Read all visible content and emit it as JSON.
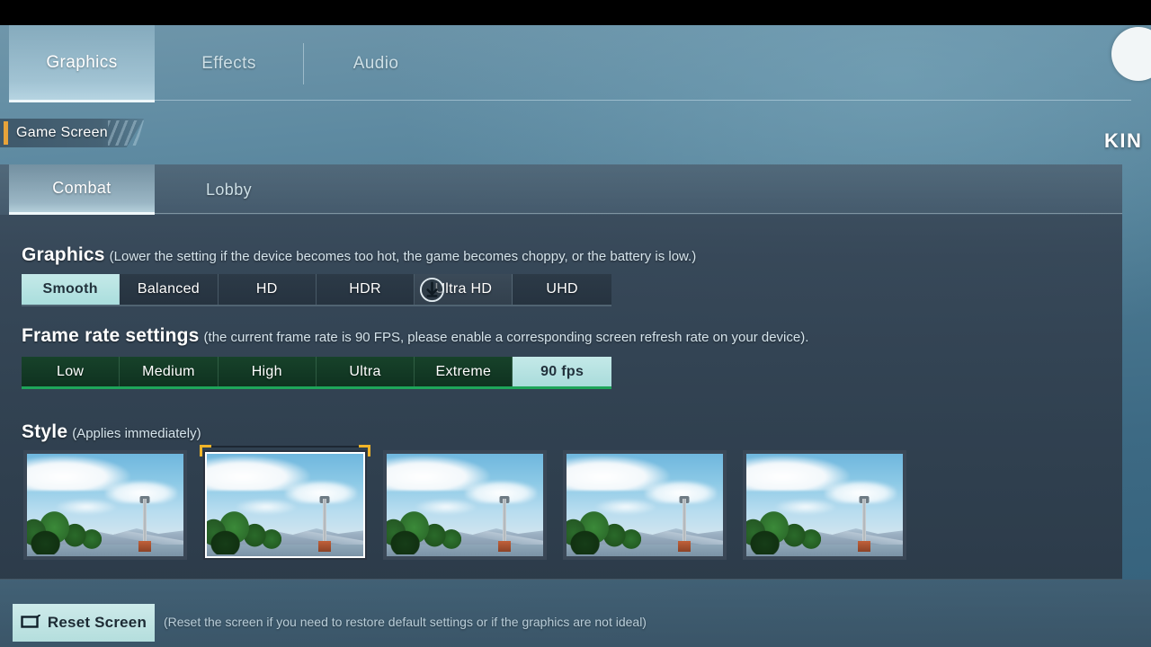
{
  "top_tabs": [
    {
      "label": "Graphics",
      "active": true
    },
    {
      "label": "Effects",
      "active": false
    },
    {
      "label": "Audio",
      "active": false
    }
  ],
  "breadcrumb": {
    "label": "Game Screen"
  },
  "brand": {
    "text": "KIN"
  },
  "sub_tabs": [
    {
      "label": "Combat",
      "active": true
    },
    {
      "label": "Lobby",
      "active": false
    }
  ],
  "sections": {
    "graphics": {
      "title": "Graphics",
      "hint": "(Lower the setting if the device becomes too hot, the game becomes choppy, or the battery is low.)",
      "options": [
        "Smooth",
        "Balanced",
        "HD",
        "HDR",
        "Ultra HD",
        "UHD"
      ],
      "selected": "Smooth",
      "hovered": "Ultra HD"
    },
    "frame_rate": {
      "title": "Frame rate settings",
      "hint": "(the current frame rate is 90 FPS, please enable a corresponding screen refresh rate on your device).",
      "options": [
        "Low",
        "Medium",
        "High",
        "Ultra",
        "Extreme",
        "90 fps"
      ],
      "selected": "90 fps"
    },
    "style": {
      "title": "Style",
      "hint": "(Applies immediately)",
      "thumbnails": [
        {
          "name": "style-1",
          "selected": false
        },
        {
          "name": "style-2",
          "selected": true
        },
        {
          "name": "style-3",
          "selected": false
        },
        {
          "name": "style-4",
          "selected": false
        },
        {
          "name": "style-5",
          "selected": false
        }
      ]
    }
  },
  "bottom_bar": {
    "reset_label": "Reset Screen",
    "reset_icon": "monitor-icon",
    "reset_hint": "(Reset the screen if you need to restore default settings or if the graphics are not ideal)"
  },
  "colors": {
    "accent_orange": "#e8a33a",
    "selected_cyan": "#b8e2e1",
    "framerate_green": "#1ea55a",
    "corner_yellow": "#f0b429"
  }
}
